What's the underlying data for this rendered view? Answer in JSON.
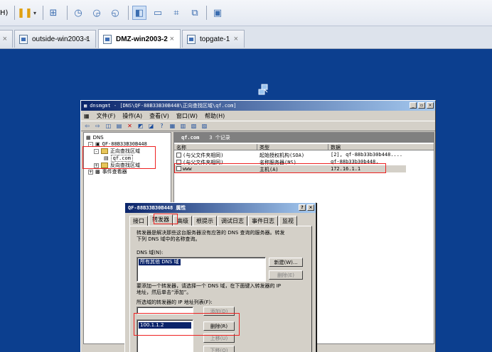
{
  "toolbar": {
    "menu_fragment": "H)",
    "icons": [
      "pause-icon",
      "dropdown-icon",
      "network-icon",
      "snapshot-icon",
      "revert-icon",
      "snapshot-manager-icon",
      "console-view-icon",
      "fullscreen-icon",
      "unity-icon",
      "window-icon",
      "quick-switch-icon"
    ]
  },
  "tabs": [
    {
      "label": "",
      "close": "×"
    },
    {
      "label": "outside-win2003-1",
      "close": "×"
    },
    {
      "label": "DMZ-win2003-2",
      "close": "×",
      "active": true
    },
    {
      "label": "topgate-1",
      "close": "×"
    }
  ],
  "mmc": {
    "title": "dnsmgmt - [DNS\\QF-88B33B30B448\\正向查找区域\\qf.com]",
    "menu": [
      "文件(F)",
      "操作(A)",
      "查看(V)",
      "窗口(W)",
      "帮助(H)"
    ],
    "tree": {
      "root": "DNS",
      "server": "QF-88B33B30B448",
      "forward": "正向查找区域",
      "zone": "qf.com",
      "reverse": "反向查找区域",
      "events": "事件查看器"
    },
    "list": {
      "zone_name": "qf.com",
      "record_count": "3 个记录",
      "columns": [
        "名称",
        "类型",
        "数据"
      ],
      "rows": [
        {
          "name": "(与父文件夹相同)",
          "type": "起始授权机构(SOA)",
          "data": "[2], qf-88b33b30b448...."
        },
        {
          "name": "(与父文件夹相同)",
          "type": "名称服务器(NS)",
          "data": "qf-88b33b30b448."
        },
        {
          "name": "www",
          "type": "主机(A)",
          "data": "172.16.1.1"
        }
      ]
    }
  },
  "dialog": {
    "title": "QF-88B33B30B448 属性",
    "help_btn": "?",
    "close_btn": "×",
    "tabs": [
      "接口",
      "转发器",
      "高级",
      "根提示",
      "调试日志",
      "事件日志",
      "监视"
    ],
    "description": [
      "转发器是解决那些这台服务器没有应答的 DNS 查询的服务器。转发",
      "下列 DNS 域中的名称查询。"
    ],
    "dns_domain_label": "DNS 域(N):",
    "dns_domain_item": "所有其他 DNS 域",
    "new_btn": "新建(W)...",
    "delete_btn_top": "删除(E)",
    "add_hint": [
      "要添加一个转发器，请选择一个 DNS 域，在下面键入转发器的 IP",
      "地址，然后单击“添加”。"
    ],
    "ip_list_label": "所选域的转发器的 IP 地址列表(F):",
    "add_btn": "添加(D)",
    "ip_item": "100.1.1.2",
    "delete_btn": "删除(R)",
    "up_btn": "上移(U)",
    "down_btn": "下移(O)"
  }
}
